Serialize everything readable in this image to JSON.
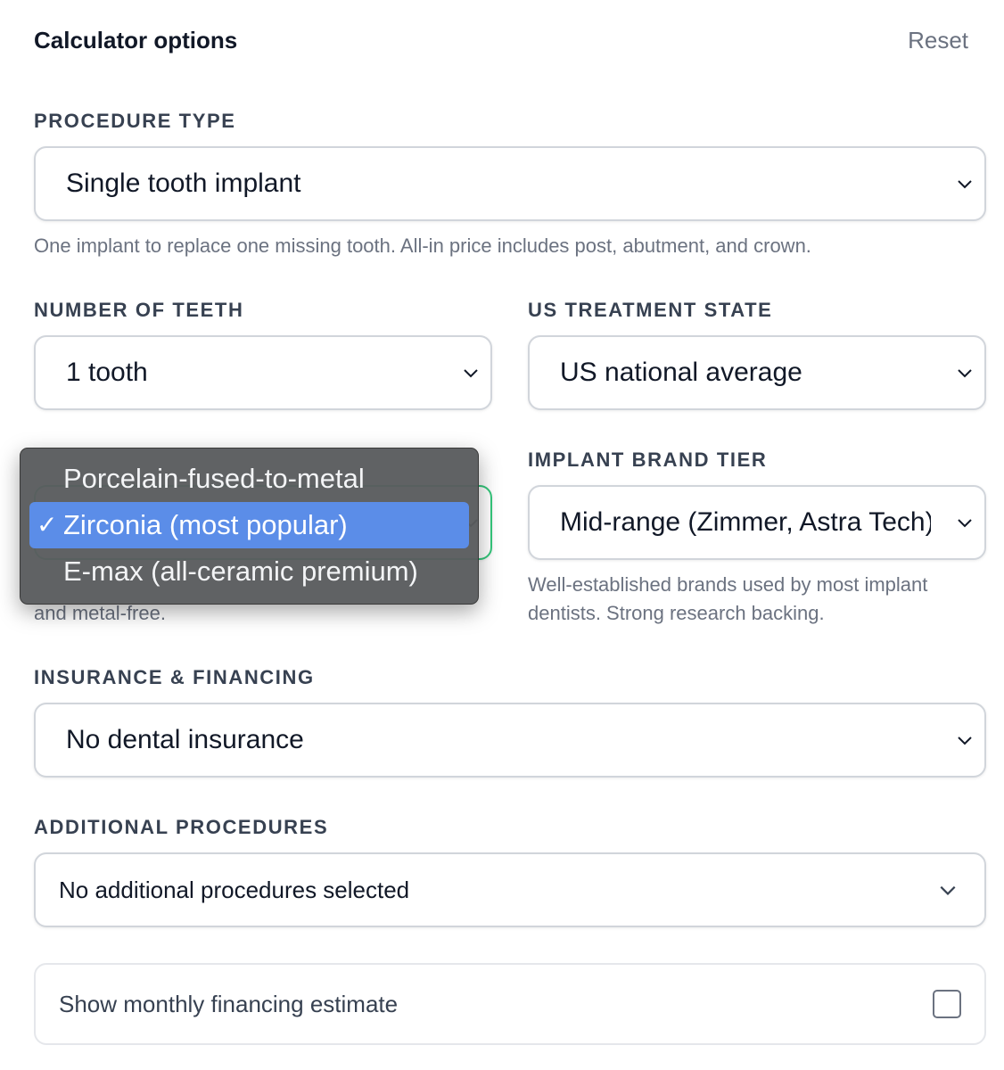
{
  "header": {
    "title": "Calculator options",
    "reset_label": "Reset"
  },
  "procedure": {
    "label": "PROCEDURE TYPE",
    "value": "Single tooth implant",
    "help": "One implant to replace one missing tooth. All-in price includes post, abutment, and crown."
  },
  "teeth": {
    "label": "NUMBER OF TEETH",
    "value": "1 tooth"
  },
  "state": {
    "label": "US TREATMENT STATE",
    "value": "US national average"
  },
  "crown": {
    "help_tail": "and metal-free.",
    "options": [
      {
        "label": "Porcelain-fused-to-metal",
        "selected": false
      },
      {
        "label": "Zirconia (most popular)",
        "selected": true
      },
      {
        "label": "E-max (all-ceramic premium)",
        "selected": false
      }
    ],
    "check_glyph": "✓"
  },
  "brand": {
    "label": "IMPLANT BRAND TIER",
    "value": "Mid-range (Zimmer, Astra Tech)",
    "help": "Well-established brands used by most implant dentists. Strong research backing."
  },
  "insurance": {
    "label": "INSURANCE & FINANCING",
    "value": "No dental insurance"
  },
  "additional": {
    "label": "ADDITIONAL PROCEDURES",
    "value": "No additional procedures selected"
  },
  "financing": {
    "label": "Show monthly financing estimate",
    "checked": false
  },
  "colors": {
    "focus_border": "#34c77b",
    "selected_option": "#5b8de8",
    "dropdown_bg": "#5a5c5e"
  }
}
